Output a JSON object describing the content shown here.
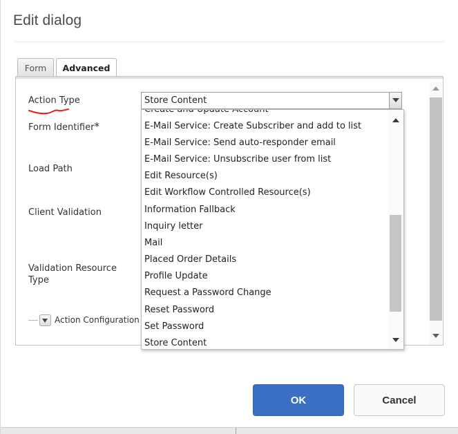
{
  "dialog": {
    "title": "Edit dialog"
  },
  "tabs": [
    {
      "label": "Form",
      "active": false
    },
    {
      "label": "Advanced",
      "active": true
    }
  ],
  "fields": {
    "action_type": "Action Type",
    "form_identifier": "Form Identifier",
    "required_marker": "*",
    "load_path": "Load Path",
    "client_validation": "Client Validation",
    "validation_resource_type_line1": "Validation Resource",
    "validation_resource_type_line2": "Type"
  },
  "action_type_select": {
    "selected": "Store Content",
    "options_visible": [
      "Create and Update Account",
      "E-Mail Service: Create Subscriber and add to list",
      "E-Mail Service: Send auto-responder email",
      "E-Mail Service: Unsubscribe user from list",
      "Edit Resource(s)",
      "Edit Workflow Controlled Resource(s)",
      "Information Fallback",
      "Inquiry letter",
      "Mail",
      "Placed Order Details",
      "Profile Update",
      "Request a Password Change",
      "Reset Password",
      "Set Password",
      "Store Content"
    ]
  },
  "action_configuration": {
    "label": "Action Configuration",
    "collapsed": true
  },
  "buttons": {
    "ok": "OK",
    "cancel": "Cancel"
  },
  "colors": {
    "primary_button": "#3a6fc3",
    "annotation_underline": "#e0201b"
  },
  "icons": {
    "dropdown": "chevron-down-icon",
    "expand": "triangle-down-icon",
    "scroll_up": "arrow-up-icon",
    "scroll_down": "arrow-down-icon"
  }
}
